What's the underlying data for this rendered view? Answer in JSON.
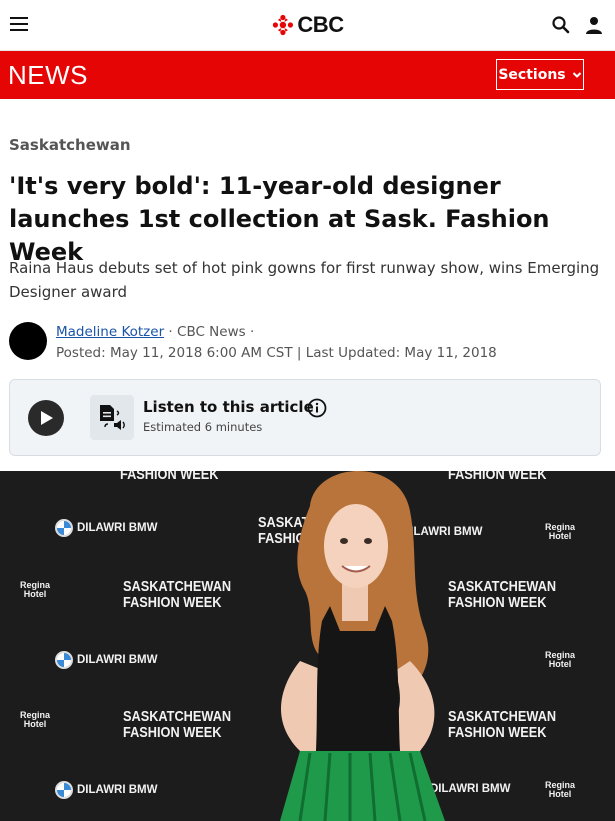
{
  "header": {
    "logo_text": "CBC",
    "menu_icon": "hamburger-menu-icon",
    "search_icon": "search-icon",
    "account_icon": "user-icon",
    "brand_color": "#e60505"
  },
  "newsbar": {
    "title": "NEWS",
    "sections_label": "Sections"
  },
  "article": {
    "category": "Saskatchewan",
    "headline": "'It's very bold': 11-year-old designer launches 1st collection at Sask. Fashion Week",
    "dek": "Raina Haus debuts set of hot pink gowns for first runway show, wins Emerging Designer award",
    "author": "Madeline Kotzer",
    "source": " · CBC News ·",
    "dates": "Posted: May 11, 2018 6:00 AM CST | Last Updated: May 11, 2018"
  },
  "listen": {
    "title": "Listen to this article",
    "estimate": "Estimated 6 minutes"
  },
  "photo": {
    "backdrop_event_line1": "SASKATCHEWAN",
    "backdrop_event_line2": "FASHION WEEK",
    "backdrop_sponsor": "DILAWRI BMW",
    "backdrop_hotel_line1": "Regina",
    "backdrop_hotel_line2": "Hotel"
  }
}
